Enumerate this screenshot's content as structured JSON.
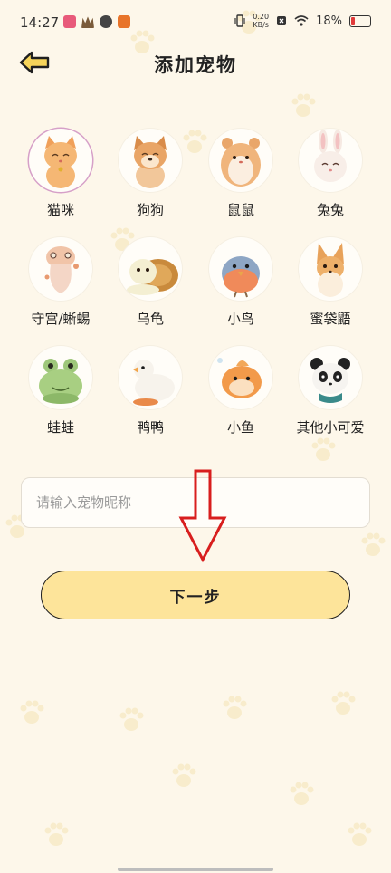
{
  "status_bar": {
    "time": "14:27",
    "network_speed_value": "0.20",
    "network_speed_unit": "KB/s",
    "battery_percent": "18%",
    "battery_level": 0.18
  },
  "header": {
    "title": "添加宠物",
    "back_icon": "back-arrow-icon"
  },
  "pets": [
    {
      "label": "猫咪",
      "icon": "cat-avatar-icon",
      "selected": true
    },
    {
      "label": "狗狗",
      "icon": "dog-avatar-icon",
      "selected": false
    },
    {
      "label": "鼠鼠",
      "icon": "hamster-avatar-icon",
      "selected": false
    },
    {
      "label": "兔兔",
      "icon": "rabbit-avatar-icon",
      "selected": false
    },
    {
      "label": "守宫/蜥蜴",
      "icon": "gecko-avatar-icon",
      "selected": false
    },
    {
      "label": "乌龟",
      "icon": "turtle-avatar-icon",
      "selected": false
    },
    {
      "label": "小鸟",
      "icon": "bird-avatar-icon",
      "selected": false
    },
    {
      "label": "蜜袋鼯",
      "icon": "sugar-glider-avatar-icon",
      "selected": false
    },
    {
      "label": "蛙蛙",
      "icon": "frog-avatar-icon",
      "selected": false
    },
    {
      "label": "鸭鸭",
      "icon": "duck-avatar-icon",
      "selected": false
    },
    {
      "label": "小鱼",
      "icon": "fish-avatar-icon",
      "selected": false
    },
    {
      "label": "其他小可爱",
      "icon": "panda-avatar-icon",
      "selected": false
    }
  ],
  "nickname_input": {
    "placeholder": "请输入宠物昵称",
    "value": ""
  },
  "next_button": {
    "label": "下一步"
  },
  "colors": {
    "background": "#fdf7ea",
    "button_fill": "#fde49a",
    "selected_ring": "#d6a0c8",
    "annotation_arrow": "#d81e1e"
  }
}
